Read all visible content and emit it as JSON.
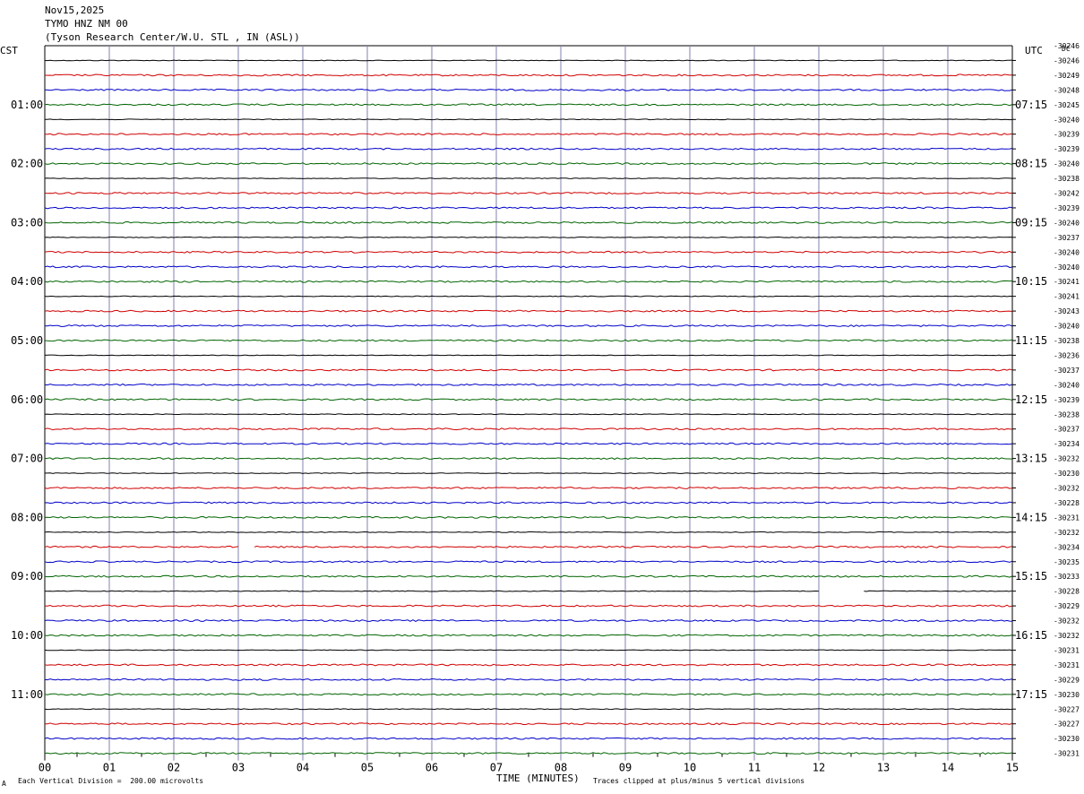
{
  "header": {
    "date": "Nov15,2025",
    "channel": "TYMO HNZ NM 00",
    "station": "(Tyson Research Center/W.U. STL , IN (ASL))"
  },
  "left_label": "CST",
  "right_label": "UTC",
  "dc_label": "DC",
  "footer": {
    "marker": "A",
    "scale": "Each Vertical Division =  200.00 microvolts",
    "xlabel": "TIME (MINUTES)",
    "clip_note": "Traces clipped at plus/minus 5 vertical divisions"
  },
  "chart_data": {
    "type": "line",
    "title": "TYMO HNZ NM 00",
    "xlabel": "TIME (MINUTES)",
    "xlim": [
      0,
      15
    ],
    "x_ticks": [
      "00",
      "01",
      "02",
      "03",
      "04",
      "05",
      "06",
      "07",
      "08",
      "09",
      "10",
      "11",
      "12",
      "13",
      "14",
      "15"
    ],
    "left_time_labels": [
      "01:00",
      "02:00",
      "03:00",
      "04:00",
      "05:00",
      "06:00",
      "07:00",
      "08:00",
      "09:00",
      "10:00",
      "11:00"
    ],
    "right_time_labels": [
      "07:15",
      "08:15",
      "09:15",
      "10:15",
      "11:15",
      "12:15",
      "13:15",
      "14:15",
      "15:15",
      "16:15",
      "17:15"
    ],
    "trace_colors": [
      "#000000",
      "#d00000",
      "#0000c8",
      "#006400"
    ],
    "dc_offsets": [
      "-30246",
      "-30249",
      "-30248",
      "-30245",
      "-30240",
      "-30239",
      "-30239",
      "-30240",
      "-30238",
      "-30242",
      "-30239",
      "-30240",
      "-30237",
      "-30240",
      "-30240",
      "-30241",
      "-30241",
      "-30243",
      "-30240",
      "-30238",
      "-30236",
      "-30237",
      "-30240",
      "-30239",
      "-30238",
      "-30237",
      "-30234",
      "-30232",
      "-30230",
      "-30232",
      "-30228",
      "-30231",
      "-30232",
      "-30234",
      "-30235",
      "-30233",
      "-30228",
      "-30229",
      "-30232",
      "-30232",
      "-30231",
      "-30231",
      "-30229",
      "-30230",
      "-30227",
      "-30227",
      "-30230",
      "-30231",
      "-30229"
    ],
    "traces_rows": 48,
    "gaps": [
      {
        "row": 33,
        "x_start_min": 3.0,
        "x_end_min": 3.25
      },
      {
        "row": 36,
        "x_start_min": 12.0,
        "x_end_min": 12.7
      }
    ]
  }
}
